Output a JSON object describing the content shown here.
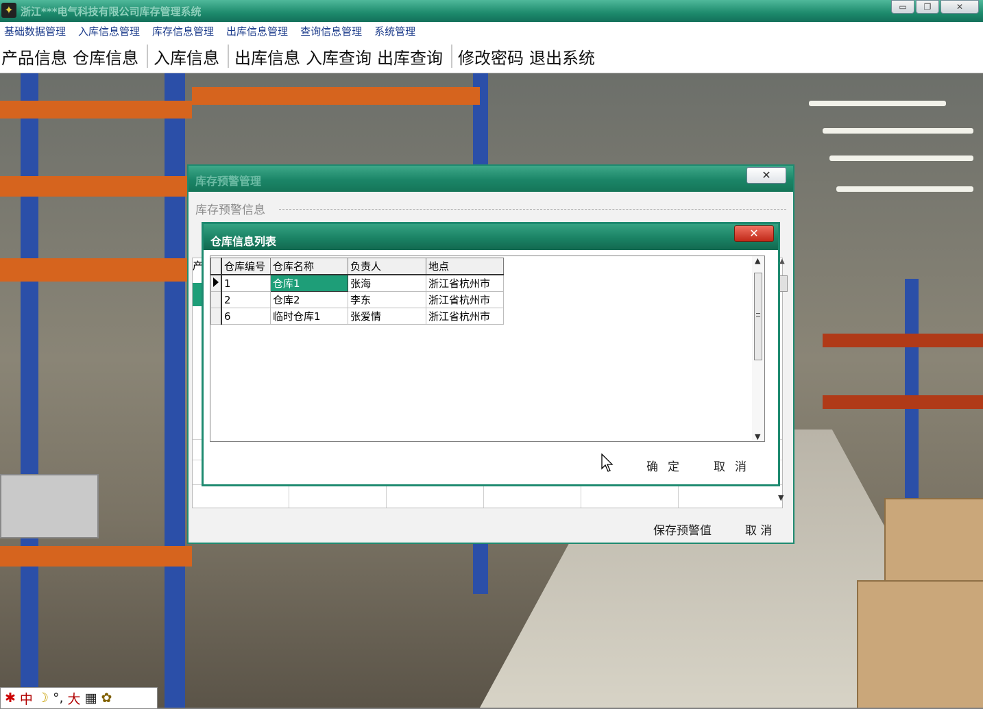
{
  "window": {
    "title": "浙江***电气科技有限公司库存管理系统"
  },
  "menubar": [
    "基础数据管理",
    "入库信息管理",
    "库存信息管理",
    "出库信息管理",
    "查询信息管理",
    "系统管理"
  ],
  "toolbar": {
    "group1": [
      "产品信息",
      "仓库信息"
    ],
    "group2": [
      "入库信息"
    ],
    "group3": [
      "出库信息",
      "入库查询",
      "出库查询"
    ],
    "group4": [
      "修改密码",
      "退出系统"
    ]
  },
  "outer_dialog": {
    "title": "库存预警管理",
    "close_glyph": "✕",
    "group_label": "库存预警信息",
    "grid_header_partial": "产",
    "save_button": "保存预警值",
    "cancel_button": "取 消"
  },
  "inner_dialog": {
    "title": "仓库信息列表",
    "close_glyph": "✕",
    "columns": [
      "仓库编号",
      "仓库名称",
      "负责人",
      "地点"
    ],
    "rows": [
      {
        "id": "1",
        "name": "仓库1",
        "manager": "张海",
        "location": "浙江省杭州市"
      },
      {
        "id": "2",
        "name": "仓库2",
        "manager": "李东",
        "location": "浙江省杭州市"
      },
      {
        "id": "6",
        "name": "临时仓库1",
        "manager": "张爱情",
        "location": "浙江省杭州市"
      }
    ],
    "ok_button": "确定",
    "cancel_button": "取消"
  },
  "taskbar": {
    "ime": "中",
    "mode": "大"
  }
}
